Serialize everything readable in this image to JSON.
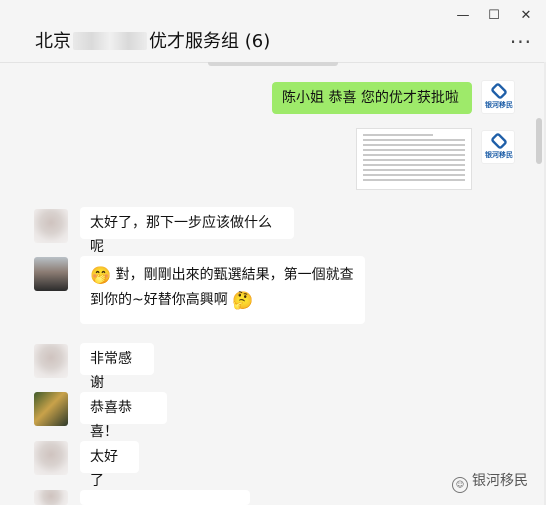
{
  "window": {
    "title_prefix": "北京",
    "title_suffix": "优才服务组 (6)",
    "controls": {
      "minimize": "—",
      "maximize": "☐",
      "close": "✕"
    },
    "more": "···"
  },
  "messages": [
    {
      "text": "陈小姐  恭喜 您的优才获批啦"
    },
    {
      "text": "太好了，那下一步应该做什么呢"
    },
    {
      "line1": "對，剛剛出來的甄選結果，第一個就查",
      "line2": "到你的~好替你高興啊",
      "emoji": "🤭",
      "emoji2": "🤔"
    },
    {
      "text": "非常感谢"
    },
    {
      "text": "恭喜恭喜！"
    },
    {
      "text": "太好了"
    }
  ],
  "logo": {
    "text": "银河移民"
  },
  "watermark": {
    "icon": "☺",
    "text": "银河移民"
  },
  "colors": {
    "self_bubble": "#9eea6a",
    "other_bubble": "#ffffff",
    "background": "#f5f5f5",
    "brand": "#1f5fa8"
  }
}
